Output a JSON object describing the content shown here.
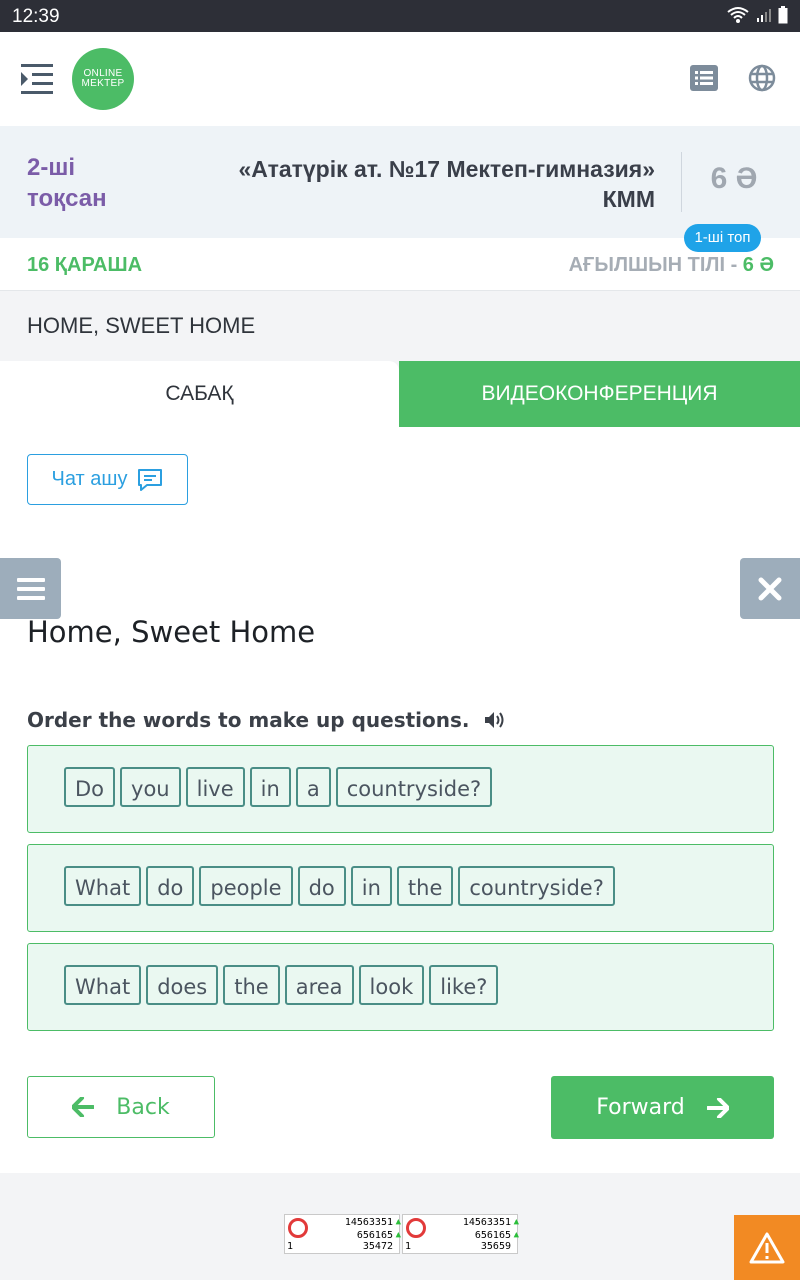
{
  "status_bar": {
    "time": "12:39"
  },
  "header": {
    "logo_line1": "ONLINE",
    "logo_line2": "MEKTEP"
  },
  "info": {
    "quarter_line1": "2-ші",
    "quarter_line2": "тоқсан",
    "school_line1": "«Ататүрік ат. №17 Мектеп-гимназия»",
    "school_line2": "КММ",
    "grade": "6 Ә"
  },
  "datebar": {
    "date": "16 ҚАРАША",
    "subject": "АҒЫЛШЫН ТІЛІ - ",
    "subject_grade": "6 Ә",
    "group": "1-ші топ"
  },
  "lesson": {
    "title": "HOME, SWEET HOME"
  },
  "tabs": {
    "lesson": "САБАҚ",
    "video": "ВИДЕОКОНФЕРЕНЦИЯ"
  },
  "chat_button": "Чат ашу",
  "exercise": {
    "title": "Home, Sweet Home",
    "instruction": "Order the words to make up questions.",
    "questions": [
      [
        "Do",
        "you",
        "live",
        "in",
        "a",
        "countryside?"
      ],
      [
        "What",
        "do",
        "people",
        "do",
        "in",
        "the",
        "countryside?"
      ],
      [
        "What",
        "does",
        "the",
        "area",
        "look",
        "like?"
      ]
    ]
  },
  "nav": {
    "back": "Back",
    "forward": "Forward"
  },
  "counters": [
    {
      "c1": "14563351",
      "c2": "656165",
      "c3": "35472",
      "one": "1"
    },
    {
      "c1": "14563351",
      "c2": "656165",
      "c3": "35659",
      "one": "1"
    }
  ],
  "colors": {
    "green": "#4cbc66",
    "blue": "#1fa3e8",
    "purple": "#7b5ca8",
    "orange": "#f28a23"
  }
}
